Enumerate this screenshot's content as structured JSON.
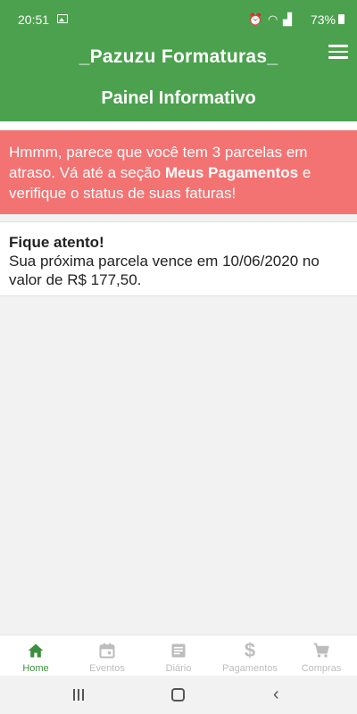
{
  "status_bar": {
    "time": "20:51",
    "battery": "73%",
    "icons": [
      "alarm-icon",
      "wifi-icon",
      "signal-icon"
    ]
  },
  "app_bar": {
    "title": "_Pazuzu Formaturas_",
    "page_title": "Painel Informativo"
  },
  "alert": {
    "text_before": "Hmmm, parece que você tem 3 parcelas em atraso. Vá até a seção ",
    "highlight": "Meus Pagamentos",
    "text_after": " e verifique o status de suas faturas!",
    "color": "#f37373"
  },
  "notice": {
    "title": "Fique atento!",
    "text": "Sua próxima parcela vence em 10/06/2020 no valor de R$ 177,50."
  },
  "bottom_nav": {
    "items": [
      {
        "label": "Home",
        "icon": "home-icon",
        "active": true
      },
      {
        "label": "Eventos",
        "icon": "calendar-icon",
        "active": false
      },
      {
        "label": "Diário",
        "icon": "journal-icon",
        "active": false
      },
      {
        "label": "Pagamentos",
        "icon": "dollar-icon",
        "active": false
      },
      {
        "label": "Compras",
        "icon": "cart-icon",
        "active": false
      }
    ]
  },
  "colors": {
    "primary": "#4ba14d",
    "nav_active": "#3b8f3e",
    "nav_inactive": "#bdbdbd"
  }
}
